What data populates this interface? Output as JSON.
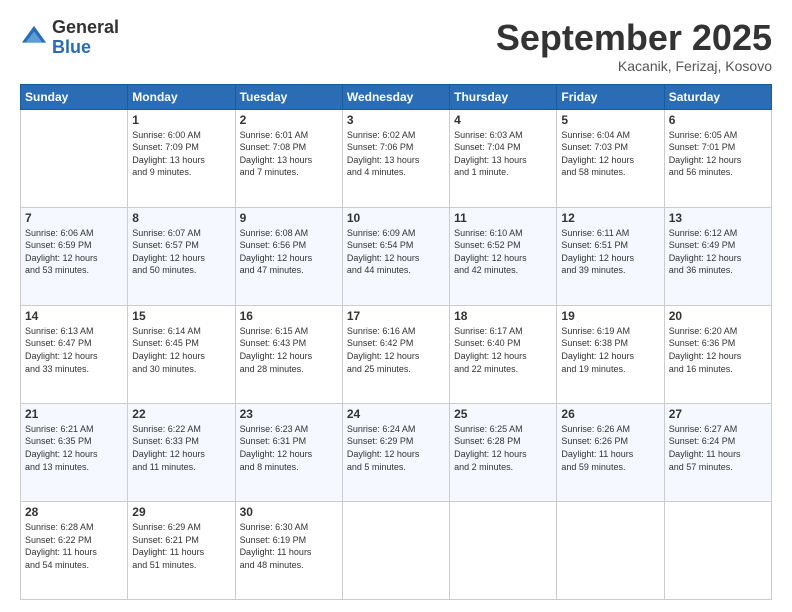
{
  "logo": {
    "general": "General",
    "blue": "Blue"
  },
  "header": {
    "month": "September 2025",
    "location": "Kacanik, Ferizaj, Kosovo"
  },
  "weekdays": [
    "Sunday",
    "Monday",
    "Tuesday",
    "Wednesday",
    "Thursday",
    "Friday",
    "Saturday"
  ],
  "weeks": [
    [
      {
        "day": "",
        "info": ""
      },
      {
        "day": "1",
        "info": "Sunrise: 6:00 AM\nSunset: 7:09 PM\nDaylight: 13 hours\nand 9 minutes."
      },
      {
        "day": "2",
        "info": "Sunrise: 6:01 AM\nSunset: 7:08 PM\nDaylight: 13 hours\nand 7 minutes."
      },
      {
        "day": "3",
        "info": "Sunrise: 6:02 AM\nSunset: 7:06 PM\nDaylight: 13 hours\nand 4 minutes."
      },
      {
        "day": "4",
        "info": "Sunrise: 6:03 AM\nSunset: 7:04 PM\nDaylight: 13 hours\nand 1 minute."
      },
      {
        "day": "5",
        "info": "Sunrise: 6:04 AM\nSunset: 7:03 PM\nDaylight: 12 hours\nand 58 minutes."
      },
      {
        "day": "6",
        "info": "Sunrise: 6:05 AM\nSunset: 7:01 PM\nDaylight: 12 hours\nand 56 minutes."
      }
    ],
    [
      {
        "day": "7",
        "info": "Sunrise: 6:06 AM\nSunset: 6:59 PM\nDaylight: 12 hours\nand 53 minutes."
      },
      {
        "day": "8",
        "info": "Sunrise: 6:07 AM\nSunset: 6:57 PM\nDaylight: 12 hours\nand 50 minutes."
      },
      {
        "day": "9",
        "info": "Sunrise: 6:08 AM\nSunset: 6:56 PM\nDaylight: 12 hours\nand 47 minutes."
      },
      {
        "day": "10",
        "info": "Sunrise: 6:09 AM\nSunset: 6:54 PM\nDaylight: 12 hours\nand 44 minutes."
      },
      {
        "day": "11",
        "info": "Sunrise: 6:10 AM\nSunset: 6:52 PM\nDaylight: 12 hours\nand 42 minutes."
      },
      {
        "day": "12",
        "info": "Sunrise: 6:11 AM\nSunset: 6:51 PM\nDaylight: 12 hours\nand 39 minutes."
      },
      {
        "day": "13",
        "info": "Sunrise: 6:12 AM\nSunset: 6:49 PM\nDaylight: 12 hours\nand 36 minutes."
      }
    ],
    [
      {
        "day": "14",
        "info": "Sunrise: 6:13 AM\nSunset: 6:47 PM\nDaylight: 12 hours\nand 33 minutes."
      },
      {
        "day": "15",
        "info": "Sunrise: 6:14 AM\nSunset: 6:45 PM\nDaylight: 12 hours\nand 30 minutes."
      },
      {
        "day": "16",
        "info": "Sunrise: 6:15 AM\nSunset: 6:43 PM\nDaylight: 12 hours\nand 28 minutes."
      },
      {
        "day": "17",
        "info": "Sunrise: 6:16 AM\nSunset: 6:42 PM\nDaylight: 12 hours\nand 25 minutes."
      },
      {
        "day": "18",
        "info": "Sunrise: 6:17 AM\nSunset: 6:40 PM\nDaylight: 12 hours\nand 22 minutes."
      },
      {
        "day": "19",
        "info": "Sunrise: 6:19 AM\nSunset: 6:38 PM\nDaylight: 12 hours\nand 19 minutes."
      },
      {
        "day": "20",
        "info": "Sunrise: 6:20 AM\nSunset: 6:36 PM\nDaylight: 12 hours\nand 16 minutes."
      }
    ],
    [
      {
        "day": "21",
        "info": "Sunrise: 6:21 AM\nSunset: 6:35 PM\nDaylight: 12 hours\nand 13 minutes."
      },
      {
        "day": "22",
        "info": "Sunrise: 6:22 AM\nSunset: 6:33 PM\nDaylight: 12 hours\nand 11 minutes."
      },
      {
        "day": "23",
        "info": "Sunrise: 6:23 AM\nSunset: 6:31 PM\nDaylight: 12 hours\nand 8 minutes."
      },
      {
        "day": "24",
        "info": "Sunrise: 6:24 AM\nSunset: 6:29 PM\nDaylight: 12 hours\nand 5 minutes."
      },
      {
        "day": "25",
        "info": "Sunrise: 6:25 AM\nSunset: 6:28 PM\nDaylight: 12 hours\nand 2 minutes."
      },
      {
        "day": "26",
        "info": "Sunrise: 6:26 AM\nSunset: 6:26 PM\nDaylight: 11 hours\nand 59 minutes."
      },
      {
        "day": "27",
        "info": "Sunrise: 6:27 AM\nSunset: 6:24 PM\nDaylight: 11 hours\nand 57 minutes."
      }
    ],
    [
      {
        "day": "28",
        "info": "Sunrise: 6:28 AM\nSunset: 6:22 PM\nDaylight: 11 hours\nand 54 minutes."
      },
      {
        "day": "29",
        "info": "Sunrise: 6:29 AM\nSunset: 6:21 PM\nDaylight: 11 hours\nand 51 minutes."
      },
      {
        "day": "30",
        "info": "Sunrise: 6:30 AM\nSunset: 6:19 PM\nDaylight: 11 hours\nand 48 minutes."
      },
      {
        "day": "",
        "info": ""
      },
      {
        "day": "",
        "info": ""
      },
      {
        "day": "",
        "info": ""
      },
      {
        "day": "",
        "info": ""
      }
    ]
  ]
}
